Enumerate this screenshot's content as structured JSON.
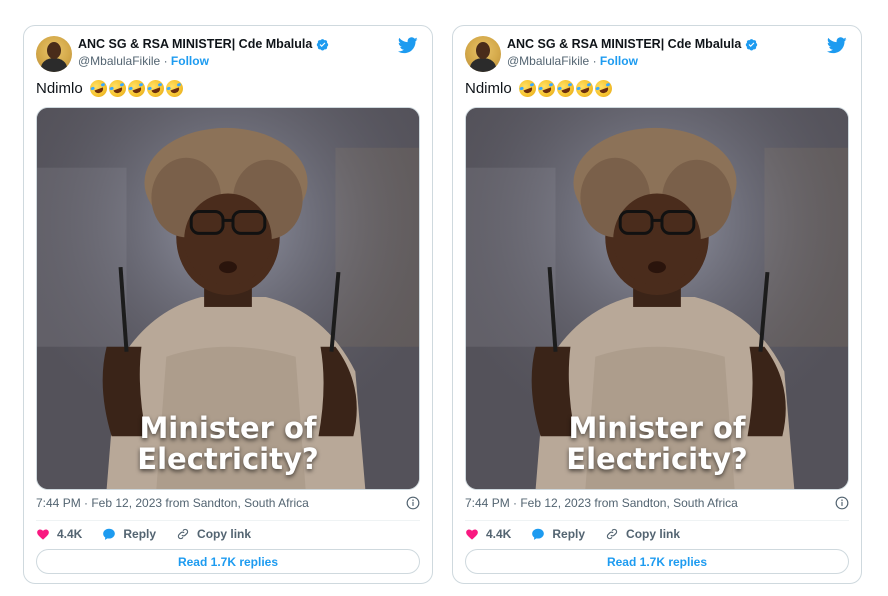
{
  "tweets": [
    {
      "author_name": "ANC SG & RSA MINISTER| Cde Mbalula",
      "handle": "@MbalulaFikile",
      "separator": "·",
      "follow_label": "Follow",
      "text": "Ndimlo",
      "emoji_count": 5,
      "image_caption_line1": "Minister of",
      "image_caption_line2": "Electricity?",
      "timestamp": "7:44 PM · Feb 12, 2023 from Sandton, South Africa",
      "likes": "4.4K",
      "reply_label": "Reply",
      "copy_link_label": "Copy link",
      "read_replies_label": "Read 1.7K replies"
    },
    {
      "author_name": "ANC SG & RSA MINISTER| Cde Mbalula",
      "handle": "@MbalulaFikile",
      "separator": "·",
      "follow_label": "Follow",
      "text": "Ndimlo",
      "emoji_count": 5,
      "image_caption_line1": "Minister of",
      "image_caption_line2": "Electricity?",
      "timestamp": "7:44 PM · Feb 12, 2023 from Sandton, South Africa",
      "likes": "4.4K",
      "reply_label": "Reply",
      "copy_link_label": "Copy link",
      "read_replies_label": "Read 1.7K replies"
    }
  ],
  "colors": {
    "twitter_blue": "#1d9bf0",
    "like_pink": "#f91880",
    "text_gray": "#536471",
    "border": "#cfd9de"
  },
  "icons": {
    "verified": "verified-badge-icon",
    "bird": "twitter-bird-icon",
    "heart": "heart-icon",
    "reply": "reply-bubble-icon",
    "link": "link-icon",
    "info": "info-icon",
    "emoji": "rolling-laughing-emoji"
  }
}
